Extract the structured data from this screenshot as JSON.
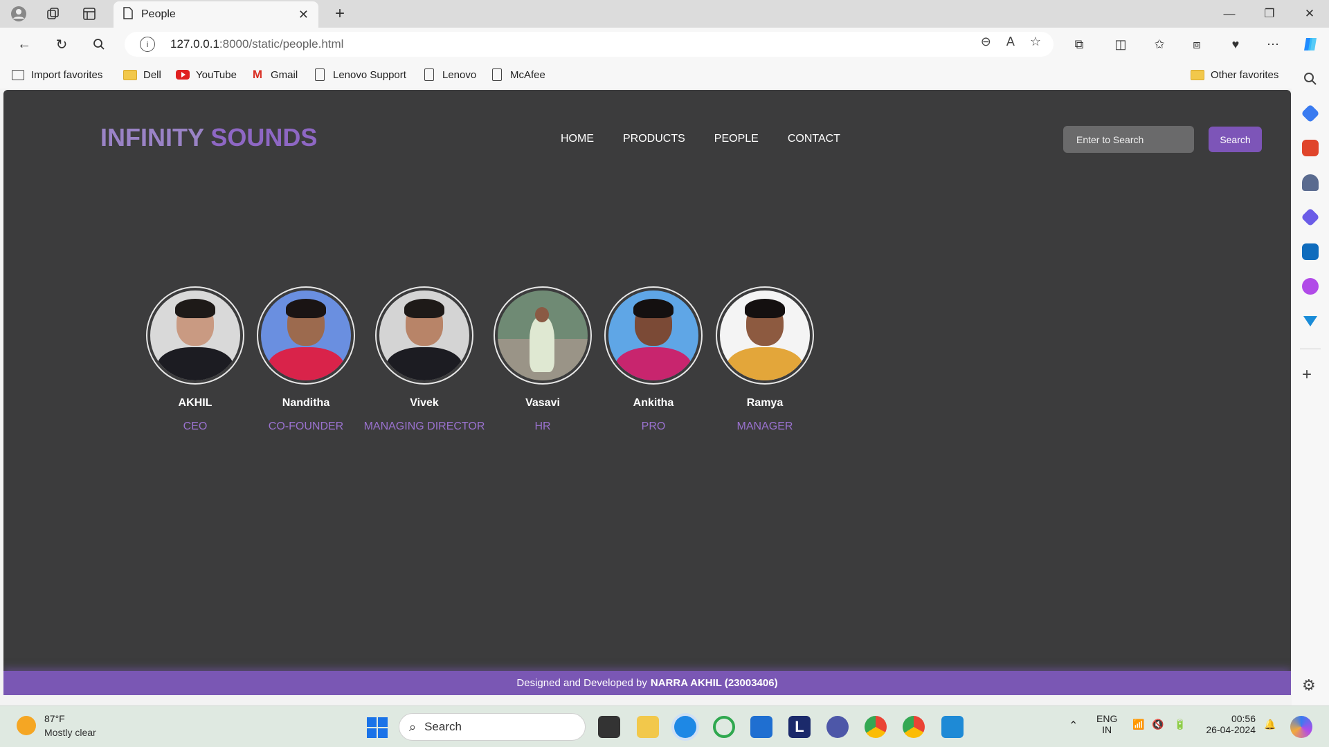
{
  "browser": {
    "tab_title": "People",
    "url_host": "127.0.0.1",
    "url_rest": ":8000/static/people.html",
    "favorites": [
      "Import favorites",
      "Dell",
      "YouTube",
      "Gmail",
      "Lenovo Support",
      "Lenovo",
      "McAfee"
    ],
    "other_favorites": "Other favorites"
  },
  "site": {
    "logo_part1": "INFINITY",
    "logo_part2": "SOUNDS",
    "nav": [
      "HOME",
      "PRODUCTS",
      "PEOPLE",
      "CONTACT"
    ],
    "search_placeholder": "Enter to Search",
    "search_button": "Search",
    "people": [
      {
        "name": "AKHIL",
        "role": "CEO"
      },
      {
        "name": "Nanditha",
        "role": "CO-FOUNDER"
      },
      {
        "name": "Vivek",
        "role": "MANAGING DIRECTOR"
      },
      {
        "name": "Vasavi",
        "role": "HR"
      },
      {
        "name": "Ankitha",
        "role": "PRO"
      },
      {
        "name": "Ramya",
        "role": "MANAGER"
      }
    ],
    "footer_prefix": "Designed and Developed by",
    "footer_author": "NARRA AKHIL (23003406)",
    "accent_color": "#7d55b8"
  },
  "taskbar": {
    "temp": "87°F",
    "weather": "Mostly clear",
    "search": "Search",
    "lang1": "ENG",
    "lang2": "IN",
    "time": "00:56",
    "date": "26-04-2024"
  }
}
